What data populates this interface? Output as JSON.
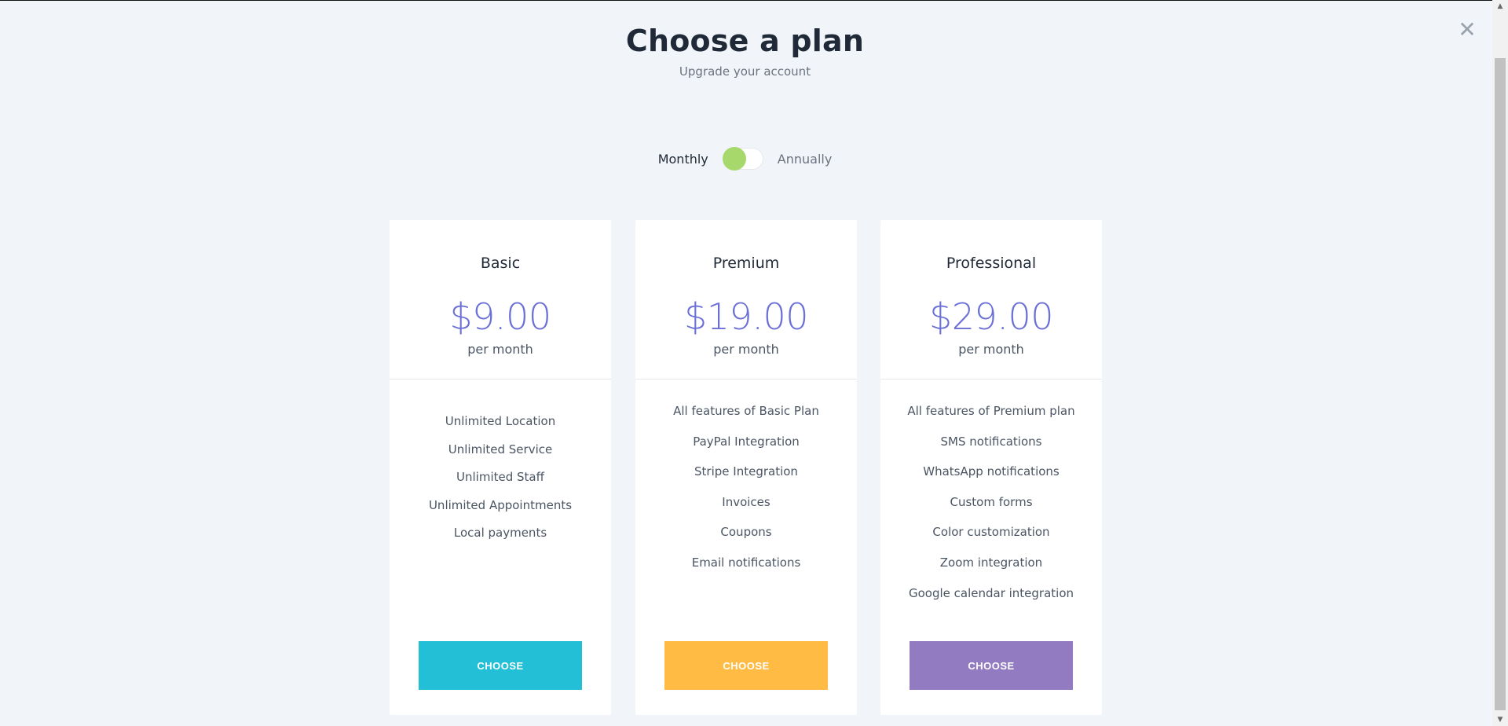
{
  "header": {
    "title": "Choose a plan",
    "subtitle": "Upgrade your account"
  },
  "billing": {
    "monthly_label": "Monthly",
    "annually_label": "Annually",
    "selected": "Monthly"
  },
  "plans": [
    {
      "name": "Basic",
      "price": "$9.00",
      "period": "per month",
      "features": [
        "Unlimited Location",
        "Unlimited Service",
        "Unlimited Staff",
        "Unlimited Appointments",
        "Local payments"
      ],
      "button": "CHOOSE",
      "button_color": "#22bfd6"
    },
    {
      "name": "Premium",
      "price": "$19.00",
      "period": "per month",
      "features": [
        "All features of Basic Plan",
        "PayPal Integration",
        "Stripe Integration",
        "Invoices",
        "Coupons",
        "Email notifications"
      ],
      "button": "CHOOSE",
      "button_color": "#ffbb44"
    },
    {
      "name": "Professional",
      "price": "$29.00",
      "period": "per month",
      "features": [
        "All features of Premium plan",
        "SMS notifications",
        "WhatsApp notifications",
        "Custom forms",
        "Color customization",
        "Zoom integration",
        "Google calendar integration"
      ],
      "button": "CHOOSE",
      "button_color": "#937bc2"
    }
  ],
  "icons": {
    "close": "close-icon"
  },
  "colors": {
    "price": "#6b70d6",
    "toggle_knob": "#a6d86b",
    "background": "#f1f5f9"
  }
}
